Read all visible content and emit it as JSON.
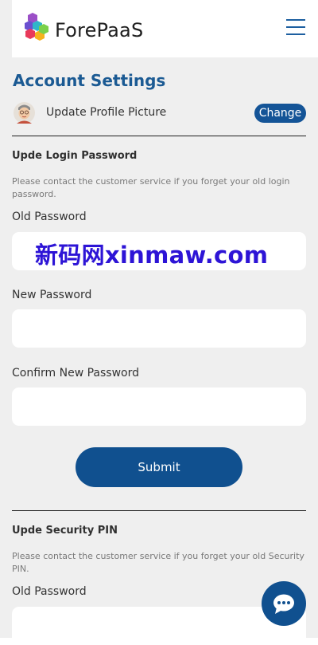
{
  "header": {
    "logo_text": "ForePaaS",
    "logo_icon": "cube-logo-icon",
    "menu_icon": "hamburger-menu-icon"
  },
  "account": {
    "title": "Account Settings",
    "profile_label": "Update Profile Picture",
    "change_label": "Change"
  },
  "login_password": {
    "title": "Upde Login Password",
    "help": "Please contact the customer service if you forget your old login password.",
    "old_label": "Old Password",
    "old_value": "",
    "new_label": "New Password",
    "new_value": "",
    "confirm_label": "Confirm New Password",
    "confirm_value": "",
    "submit_label": "Submit"
  },
  "security_pin": {
    "title": "Upde Security PIN",
    "help": "Please contact the customer service if you forget your old Security PIN.",
    "old_label": "Old Password",
    "old_value": ""
  },
  "watermark": "新码网xinmaw.com",
  "chat_icon": "chat-bubble-icon",
  "colors": {
    "primary": "#10508f",
    "title": "#1b5a93",
    "background": "#efefef",
    "watermark": "#2d14d6"
  }
}
